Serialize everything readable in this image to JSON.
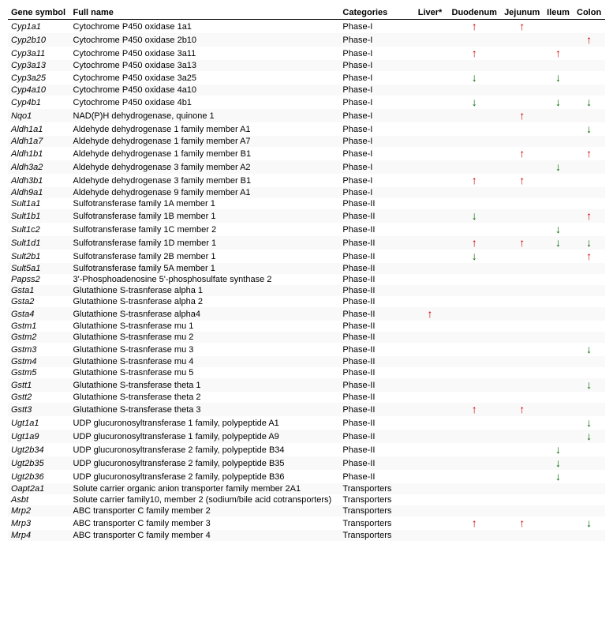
{
  "table": {
    "headers": {
      "gene": "Gene symbol",
      "name": "Full name",
      "cat": "Categories",
      "liver": "Liver*",
      "duo": "Duodenum",
      "jej": "Jejunum",
      "il": "Ileum",
      "col": "Colon"
    },
    "rows": [
      {
        "gene": "Cyp1a1",
        "name": "Cytochrome P450 oxidase 1a1",
        "cat": "Phase-I",
        "liver": "",
        "duo": "up-red",
        "jej": "up-red",
        "il": "",
        "col": ""
      },
      {
        "gene": "Cyp2b10",
        "name": "Cytochrome P450 oxidase 2b10",
        "cat": "Phase-I",
        "liver": "",
        "duo": "",
        "jej": "",
        "il": "",
        "col": "up-red"
      },
      {
        "gene": "Cyp3a11",
        "name": "Cytochrome P450 oxidase 3a11",
        "cat": "Phase-I",
        "liver": "",
        "duo": "up-red",
        "jej": "",
        "il": "up-red",
        "col": ""
      },
      {
        "gene": "Cyp3a13",
        "name": "Cytochrome P450 oxidase 3a13",
        "cat": "Phase-I",
        "liver": "",
        "duo": "",
        "jej": "",
        "il": "",
        "col": ""
      },
      {
        "gene": "Cyp3a25",
        "name": "Cytochrome P450 oxidase 3a25",
        "cat": "Phase-I",
        "liver": "",
        "duo": "down-green",
        "jej": "",
        "il": "down-green",
        "col": ""
      },
      {
        "gene": "Cyp4a10",
        "name": "Cytochrome P450 oxidase 4a10",
        "cat": "Phase-I",
        "liver": "",
        "duo": "",
        "jej": "",
        "il": "",
        "col": ""
      },
      {
        "gene": "Cyp4b1",
        "name": "Cytochrome P450 oxidase 4b1",
        "cat": "Phase-I",
        "liver": "",
        "duo": "down-green",
        "jej": "",
        "il": "down-green",
        "col": "down-green"
      },
      {
        "gene": "Nqo1",
        "name": "NAD(P)H dehydrogenase, quinone 1",
        "cat": "Phase-I",
        "liver": "",
        "duo": "",
        "jej": "up-red",
        "il": "",
        "col": ""
      },
      {
        "gene": "Aldh1a1",
        "name": "Aldehyde dehydrogenase 1 family member A1",
        "cat": "Phase-I",
        "liver": "",
        "duo": "",
        "jej": "",
        "il": "",
        "col": "down-green"
      },
      {
        "gene": "Aldh1a7",
        "name": "Aldehyde dehydrogenase 1 family member A7",
        "cat": "Phase-I",
        "liver": "",
        "duo": "",
        "jej": "",
        "il": "",
        "col": ""
      },
      {
        "gene": "Aldh1b1",
        "name": "Aldehyde dehydrogenase 1 family member B1",
        "cat": "Phase-I",
        "liver": "",
        "duo": "",
        "jej": "up-red",
        "il": "",
        "col": "up-red"
      },
      {
        "gene": "Aldh3a2",
        "name": "Aldehyde dehydrogenase 3 family member A2",
        "cat": "Phase-I",
        "liver": "",
        "duo": "",
        "jej": "",
        "il": "down-green",
        "col": ""
      },
      {
        "gene": "Aldh3b1",
        "name": "Aldehyde dehydrogenase 3 family member B1",
        "cat": "Phase-I",
        "liver": "",
        "duo": "up-red",
        "jej": "up-red",
        "il": "",
        "col": ""
      },
      {
        "gene": "Aldh9a1",
        "name": "Aldehyde dehydrogenase 9 family member A1",
        "cat": "Phase-I",
        "liver": "",
        "duo": "",
        "jej": "",
        "il": "",
        "col": ""
      },
      {
        "gene": "Sult1a1",
        "name": "Sulfotransferase family 1A member 1",
        "cat": "Phase-II",
        "liver": "",
        "duo": "",
        "jej": "",
        "il": "",
        "col": ""
      },
      {
        "gene": "Sult1b1",
        "name": "Sulfotransferase family 1B member 1",
        "cat": "Phase-II",
        "liver": "",
        "duo": "down-green",
        "jej": "",
        "il": "",
        "col": "up-red"
      },
      {
        "gene": "Sult1c2",
        "name": "Sulfotransferase family 1C member 2",
        "cat": "Phase-II",
        "liver": "",
        "duo": "",
        "jej": "",
        "il": "down-green",
        "col": ""
      },
      {
        "gene": "Sult1d1",
        "name": "Sulfotransferase family 1D member 1",
        "cat": "Phase-II",
        "liver": "",
        "duo": "up-red",
        "jej": "up-red",
        "il": "down-green",
        "col": "down-green"
      },
      {
        "gene": "Sult2b1",
        "name": "Sulfotransferase family 2B member 1",
        "cat": "Phase-II",
        "liver": "",
        "duo": "down-green",
        "jej": "",
        "il": "",
        "col": "up-red"
      },
      {
        "gene": "Sult5a1",
        "name": "Sulfotransferase family 5A member 1",
        "cat": "Phase-II",
        "liver": "",
        "duo": "",
        "jej": "",
        "il": "",
        "col": ""
      },
      {
        "gene": "Papss2",
        "name": "3'-Phosphoadenosine 5'-phosphosulfate synthase 2",
        "cat": "Phase-II",
        "liver": "",
        "duo": "",
        "jej": "",
        "il": "",
        "col": ""
      },
      {
        "gene": "Gsta1",
        "name": "Glutathione S-trasnferase alpha 1",
        "cat": "Phase-II",
        "liver": "",
        "duo": "",
        "jej": "",
        "il": "",
        "col": ""
      },
      {
        "gene": "Gsta2",
        "name": "Glutathione S-trasnferase alpha 2",
        "cat": "Phase-II",
        "liver": "",
        "duo": "",
        "jej": "",
        "il": "",
        "col": ""
      },
      {
        "gene": "Gsta4",
        "name": "Glutathione S-trasnferase alpha4",
        "cat": "Phase-II",
        "liver": "up-red",
        "duo": "",
        "jej": "",
        "il": "",
        "col": ""
      },
      {
        "gene": "Gstm1",
        "name": "Glutathione S-trasnferase mu 1",
        "cat": "Phase-II",
        "liver": "",
        "duo": "",
        "jej": "",
        "il": "",
        "col": ""
      },
      {
        "gene": "Gstm2",
        "name": "Glutathione S-trasnferase mu 2",
        "cat": "Phase-II",
        "liver": "",
        "duo": "",
        "jej": "",
        "il": "",
        "col": ""
      },
      {
        "gene": "Gstm3",
        "name": "Glutathione S-trasnferase mu 3",
        "cat": "Phase-II",
        "liver": "",
        "duo": "",
        "jej": "",
        "il": "",
        "col": "down-green"
      },
      {
        "gene": "Gstm4",
        "name": "Glutathione S-trasnferase mu 4",
        "cat": "Phase-II",
        "liver": "",
        "duo": "",
        "jej": "",
        "il": "",
        "col": ""
      },
      {
        "gene": "Gstm5",
        "name": "Glutathione S-trasnferase mu 5",
        "cat": "Phase-II",
        "liver": "",
        "duo": "",
        "jej": "",
        "il": "",
        "col": ""
      },
      {
        "gene": "Gstt1",
        "name": "Glutathione S-transferase theta 1",
        "cat": "Phase-II",
        "liver": "",
        "duo": "",
        "jej": "",
        "il": "",
        "col": "down-green"
      },
      {
        "gene": "Gstt2",
        "name": "Glutathione S-transferase theta 2",
        "cat": "Phase-II",
        "liver": "",
        "duo": "",
        "jej": "",
        "il": "",
        "col": ""
      },
      {
        "gene": "Gstt3",
        "name": "Glutathione S-transferase theta 3",
        "cat": "Phase-II",
        "liver": "",
        "duo": "up-red",
        "jej": "up-red",
        "il": "",
        "col": ""
      },
      {
        "gene": "Ugt1a1",
        "name": "UDP glucuronosyltransferase 1 family, polypeptide A1",
        "cat": "Phase-II",
        "liver": "",
        "duo": "",
        "jej": "",
        "il": "",
        "col": "down-green"
      },
      {
        "gene": "Ugt1a9",
        "name": "UDP glucuronosyltransferase 1 family, polypeptide A9",
        "cat": "Phase-II",
        "liver": "",
        "duo": "",
        "jej": "",
        "il": "",
        "col": "down-green"
      },
      {
        "gene": "Ugt2b34",
        "name": "UDP glucuronosyltransferase 2 family, polypeptide B34",
        "cat": "Phase-II",
        "liver": "",
        "duo": "",
        "jej": "",
        "il": "down-green",
        "col": ""
      },
      {
        "gene": "Ugt2b35",
        "name": "UDP glucuronosyltransferase 2 family, polypeptide B35",
        "cat": "Phase-II",
        "liver": "",
        "duo": "",
        "jej": "",
        "il": "down-green",
        "col": ""
      },
      {
        "gene": "Ugt2b36",
        "name": "UDP glucuronosyltransferase 2 family, polypeptide B36",
        "cat": "Phase-II",
        "liver": "",
        "duo": "",
        "jej": "",
        "il": "down-green",
        "col": ""
      },
      {
        "gene": "Oapt2a1",
        "name": "Solute carrier organic anion transporter family member 2A1",
        "cat": "Transporters",
        "liver": "",
        "duo": "",
        "jej": "",
        "il": "",
        "col": ""
      },
      {
        "gene": "Asbt",
        "name": "Solute carrier family10, member 2 (sodium/bile acid cotransporters)",
        "cat": "Transporters",
        "liver": "",
        "duo": "",
        "jej": "",
        "il": "",
        "col": ""
      },
      {
        "gene": "Mrp2",
        "name": "ABC transporter C family member 2",
        "cat": "Transporters",
        "liver": "",
        "duo": "",
        "jej": "",
        "il": "",
        "col": ""
      },
      {
        "gene": "Mrp3",
        "name": "ABC transporter C family member 3",
        "cat": "Transporters",
        "liver": "",
        "duo": "up-red",
        "jej": "up-red",
        "il": "",
        "col": "down-green"
      },
      {
        "gene": "Mrp4",
        "name": "ABC transporter C family member 4",
        "cat": "Transporters",
        "liver": "",
        "duo": "",
        "jej": "",
        "il": "",
        "col": ""
      }
    ]
  }
}
